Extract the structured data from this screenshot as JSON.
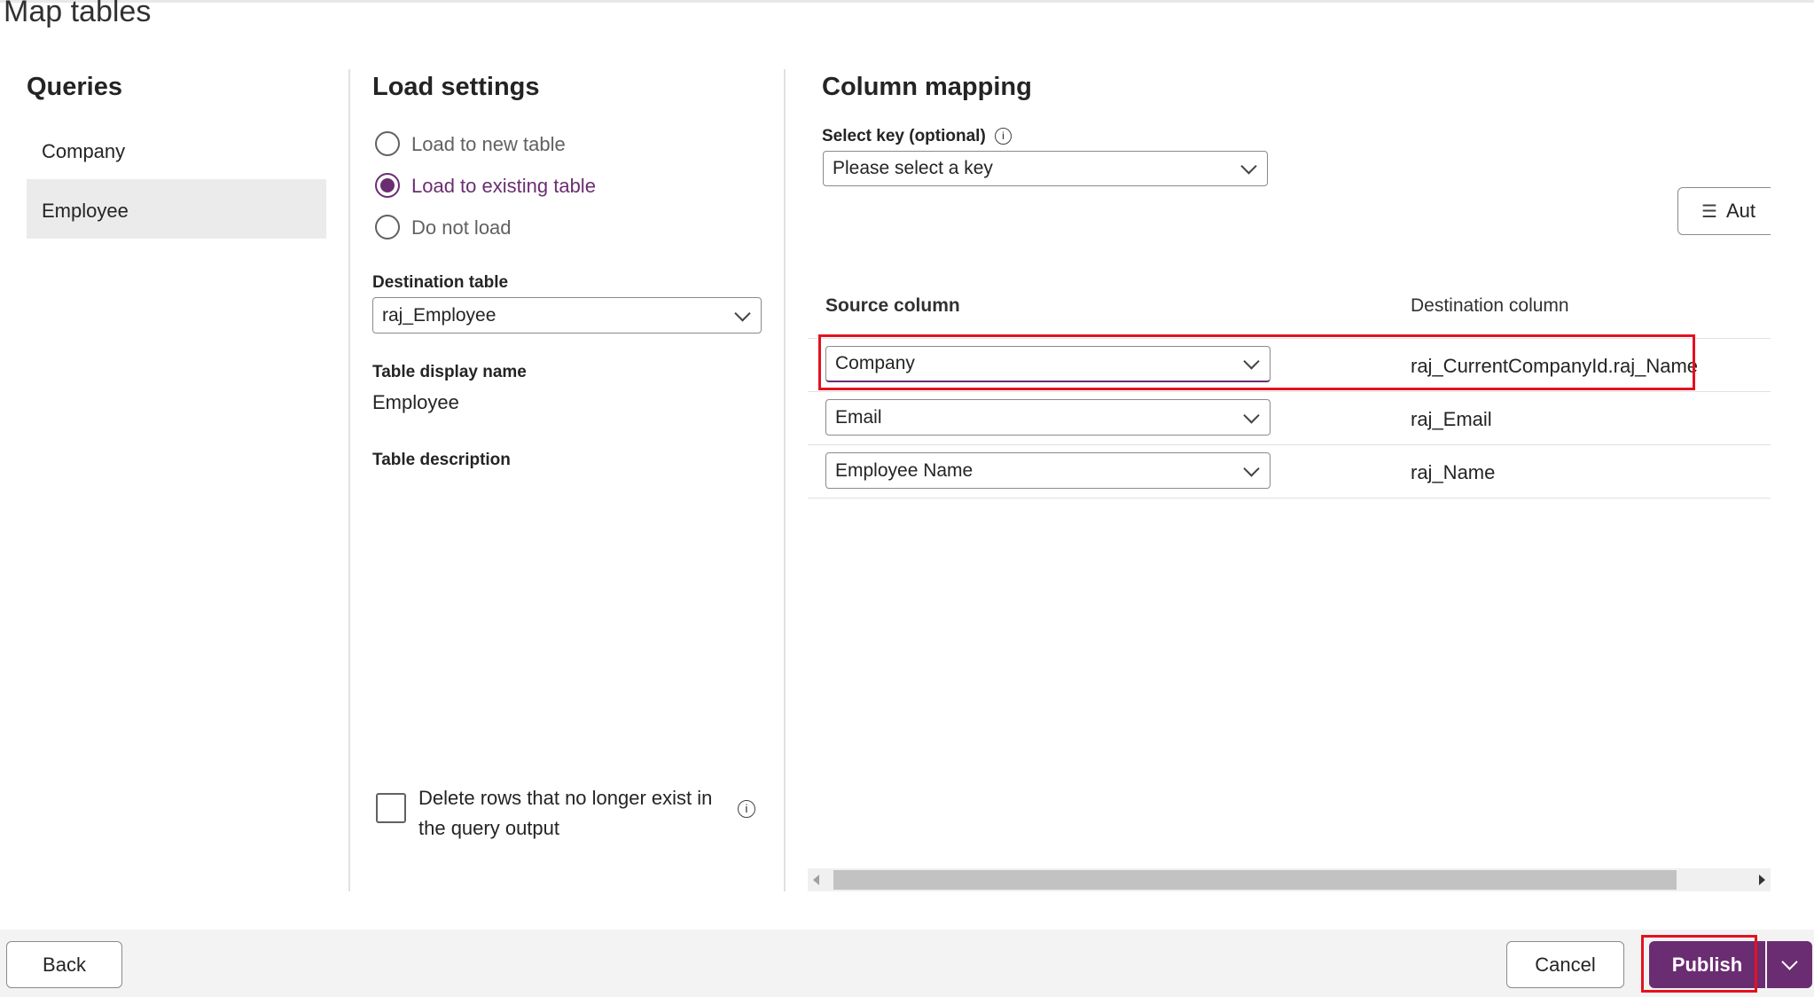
{
  "title": "Map tables",
  "queries": {
    "heading": "Queries",
    "items": [
      {
        "label": "Company",
        "selected": false
      },
      {
        "label": "Employee",
        "selected": true
      }
    ]
  },
  "load_settings": {
    "heading": "Load settings",
    "options": [
      {
        "label": "Load to new table",
        "selected": false
      },
      {
        "label": "Load to existing table",
        "selected": true
      },
      {
        "label": "Do not load",
        "selected": false
      }
    ],
    "destination_table_label": "Destination table",
    "destination_table_value": "raj_Employee",
    "display_name_label": "Table display name",
    "display_name_value": "Employee",
    "description_label": "Table description",
    "delete_rows_line1": "Delete rows that no longer exist in",
    "delete_rows_line2": "the query output",
    "delete_rows_checked": false
  },
  "column_mapping": {
    "heading": "Column mapping",
    "select_key_label": "Select key (optional)",
    "select_key_placeholder": "Please select a key",
    "auto_button": "Aut",
    "source_header": "Source column",
    "destination_header": "Destination column",
    "rows": [
      {
        "source": "Company",
        "destination": "raj_CurrentCompanyId.raj_Name"
      },
      {
        "source": "Email",
        "destination": "raj_Email"
      },
      {
        "source": "Employee Name",
        "destination": "raj_Name"
      }
    ]
  },
  "footer": {
    "back": "Back",
    "cancel": "Cancel",
    "publish": "Publish"
  },
  "colors": {
    "accent": "#6b2d72",
    "highlight": "#e3121f"
  }
}
